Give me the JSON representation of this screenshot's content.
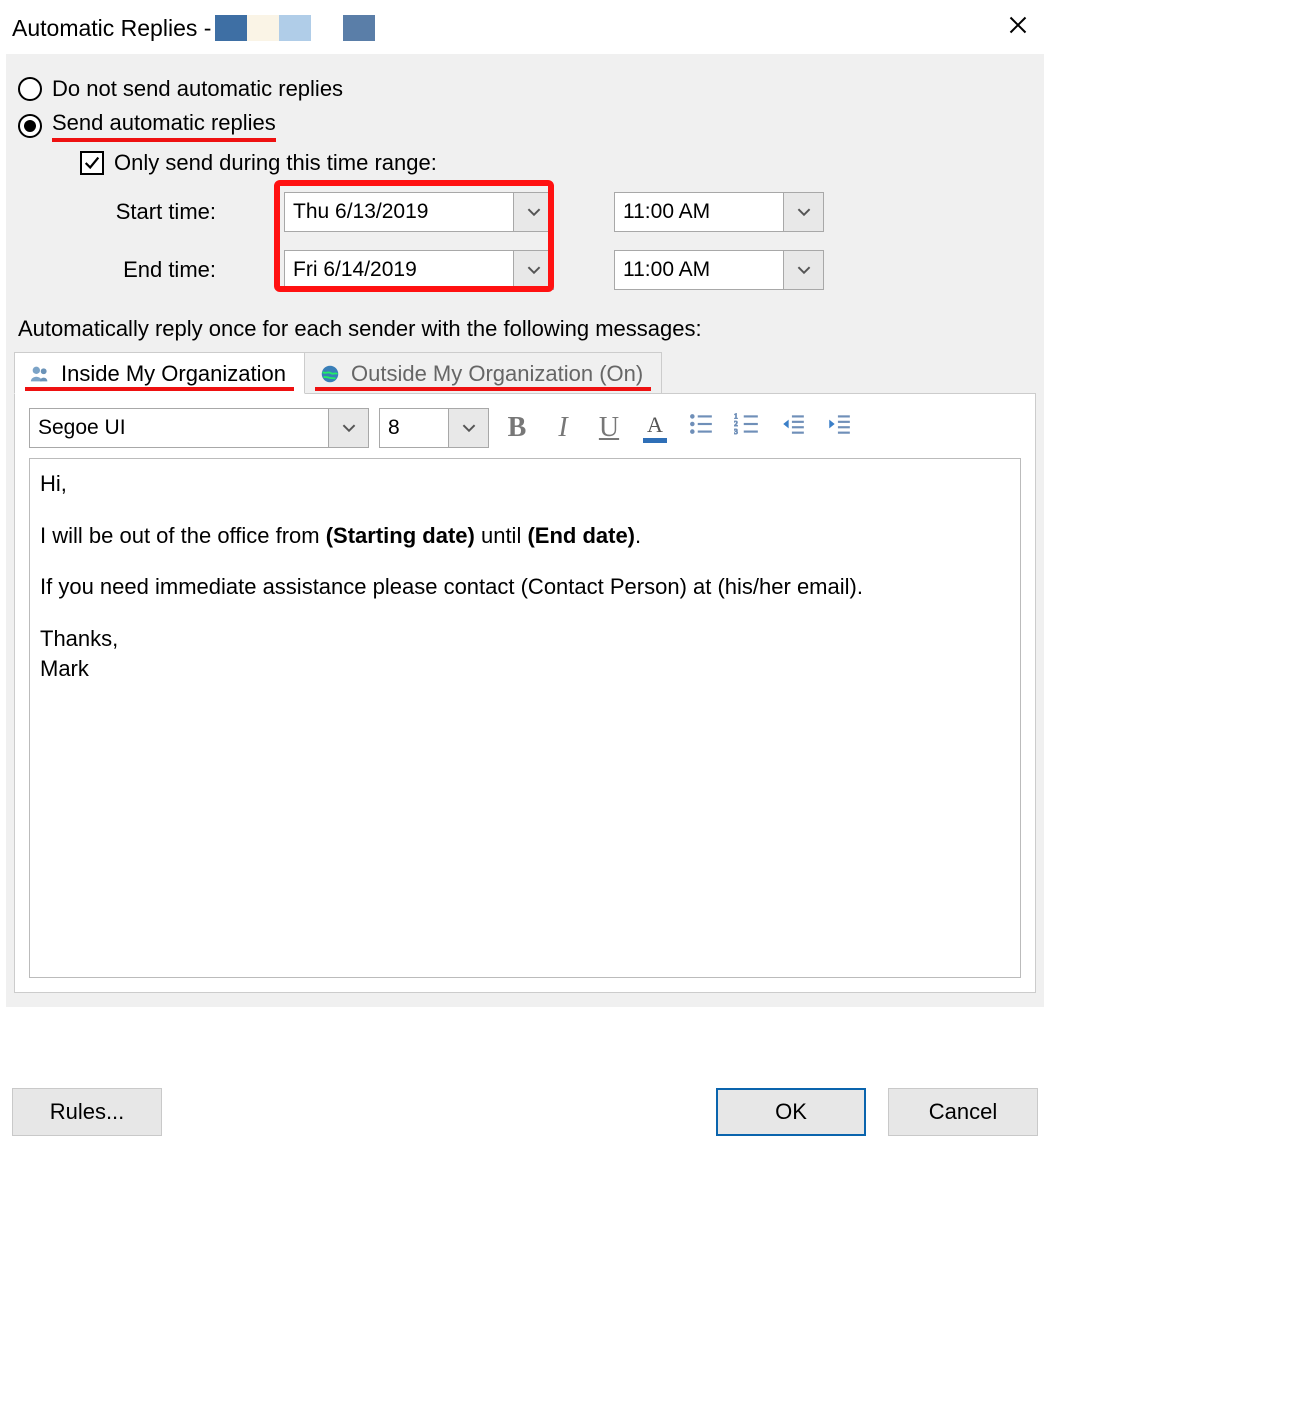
{
  "title": "Automatic Replies - ",
  "options": {
    "do_not_send": "Do not send automatic replies",
    "send": "Send automatic replies",
    "only_send_range": "Only send during this time range:",
    "start_label": "Start time:",
    "end_label": "End time:",
    "start_date": "Thu 6/13/2019",
    "end_date": "Fri 6/14/2019",
    "start_time": "11:00 AM",
    "end_time": "11:00 AM"
  },
  "caption": "Automatically reply once for each sender with the following messages:",
  "tabs": {
    "inside": "Inside My Organization",
    "outside": "Outside My Organization (On)"
  },
  "toolbar": {
    "font": "Segoe UI",
    "size": "8"
  },
  "message": {
    "greeting": "Hi,",
    "line_pre": "I will be out of the office from ",
    "start_bold": "(Starting date)",
    "mid": " until ",
    "end_bold": "(End date)",
    "period": ".",
    "assist": "If you need immediate assistance please contact (Contact Person) at (his/her email).",
    "thanks": "Thanks,",
    "name": "Mark"
  },
  "footer": {
    "rules": "Rules...",
    "ok": "OK",
    "cancel": "Cancel"
  }
}
